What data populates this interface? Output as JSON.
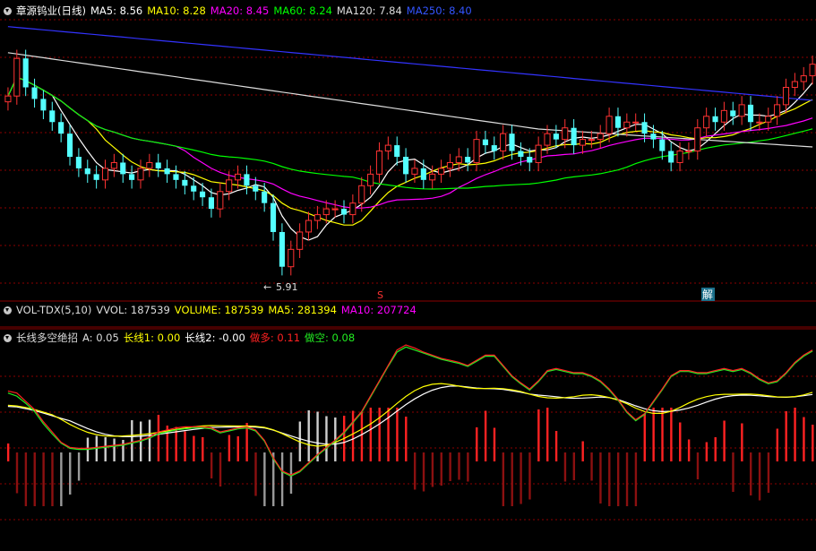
{
  "main_header": {
    "title": "章源钨业(日线)",
    "ma5": "MA5: 8.56",
    "ma10": "MA10: 8.28",
    "ma20": "MA20: 8.45",
    "ma60": "MA60: 8.24",
    "ma120": "MA120: 7.84",
    "ma250": "MA250: 8.40"
  },
  "main_chart": {
    "low_label": "5.91",
    "marker_s": "S",
    "marker_jie": "解"
  },
  "vol_header": {
    "title": "VOL-TDX(5,10)",
    "vvol": "VVOL: 187539",
    "volume": "VOLUME: 187539",
    "ma5": "MA5: 281394",
    "ma10": "MA10: 207724"
  },
  "ind_header": {
    "title": "长线多空绝招",
    "a": "A: 0.05",
    "l1": "长线1: 0.00",
    "l2": "长线2: -0.00",
    "duo": "做多: 0.11",
    "kong": "做空: 0.08"
  },
  "colors": {
    "up": "#ff3333",
    "down": "#54ffff",
    "ma5": "#ffffff",
    "ma10": "#ffff00",
    "ma20": "#ff00ff",
    "ma60": "#00ff00",
    "ma120": "#dddddd",
    "ma250": "#3333ff",
    "grid": "#8b0000"
  },
  "chart_data": [
    {
      "type": "candlestick",
      "title": "章源钨业(日线)",
      "price_range": [
        5.5,
        10.3
      ],
      "min_price_label": 5.91,
      "close": [
        8.95,
        9.6,
        9.1,
        8.9,
        8.7,
        8.5,
        8.3,
        7.9,
        7.7,
        7.6,
        7.5,
        7.7,
        7.8,
        7.6,
        7.5,
        7.7,
        7.8,
        7.7,
        7.6,
        7.5,
        7.4,
        7.3,
        7.2,
        7.0,
        7.3,
        7.5,
        7.6,
        7.4,
        7.3,
        7.1,
        6.6,
        6.0,
        6.3,
        6.6,
        6.8,
        6.9,
        7.0,
        7.0,
        6.9,
        7.1,
        7.4,
        7.6,
        8.0,
        8.1,
        7.9,
        7.6,
        7.7,
        7.5,
        7.6,
        7.7,
        7.8,
        7.9,
        7.8,
        8.2,
        8.1,
        8.0,
        8.3,
        8.0,
        7.9,
        7.8,
        8.1,
        8.3,
        8.2,
        8.4,
        8.1,
        8.2,
        8.2,
        8.3,
        8.6,
        8.4,
        8.5,
        8.5,
        8.3,
        8.2,
        8.0,
        7.8,
        8.0,
        8.0,
        8.4,
        8.6,
        8.5,
        8.7,
        8.6,
        8.8,
        8.5,
        8.5,
        8.6,
        8.8,
        9.1,
        9.2,
        9.3,
        9.5
      ],
      "ma_latest": {
        "MA5": 8.56,
        "MA10": 8.28,
        "MA20": 8.45,
        "MA60": 8.24,
        "MA120": 7.84,
        "MA250": 8.4
      }
    },
    {
      "type": "bar",
      "title": "VOL-TDX(5,10)",
      "VVOL": 187539,
      "VOLUME": 187539,
      "MA5": 281394,
      "MA10": 207724
    },
    {
      "type": "line",
      "title": "长线多空绝招",
      "series": [
        {
          "name": "做多",
          "values": [
            0.6,
            0.58,
            0.5,
            0.42,
            0.3,
            0.2,
            0.1,
            0.05,
            0.04,
            0.04,
            0.05,
            0.06,
            0.07,
            0.08,
            0.1,
            0.12,
            0.15,
            0.2,
            0.22,
            0.24,
            0.25,
            0.25,
            0.25,
            0.24,
            0.2,
            0.22,
            0.24,
            0.25,
            0.22,
            0.12,
            -0.05,
            -0.18,
            -0.22,
            -0.18,
            -0.1,
            -0.02,
            0.05,
            0.12,
            0.2,
            0.3,
            0.4,
            0.55,
            0.7,
            0.85,
            1.0,
            1.05,
            1.02,
            0.98,
            0.95,
            0.92,
            0.9,
            0.88,
            0.85,
            0.9,
            0.95,
            0.95,
            0.85,
            0.75,
            0.68,
            0.62,
            0.7,
            0.8,
            0.82,
            0.8,
            0.78,
            0.78,
            0.75,
            0.7,
            0.62,
            0.52,
            0.4,
            0.32,
            0.38,
            0.5,
            0.62,
            0.75,
            0.8,
            0.8,
            0.78,
            0.78,
            0.8,
            0.82,
            0.8,
            0.82,
            0.78,
            0.72,
            0.68,
            0.7,
            0.78,
            0.88,
            0.95,
            1.0
          ]
        },
        {
          "name": "做空",
          "values": [
            0.58,
            0.55,
            0.48,
            0.4,
            0.28,
            0.18,
            0.09,
            0.04,
            0.03,
            0.03,
            0.04,
            0.05,
            0.06,
            0.07,
            0.09,
            0.11,
            0.14,
            0.18,
            0.2,
            0.22,
            0.23,
            0.24,
            0.24,
            0.23,
            0.19,
            0.21,
            0.23,
            0.24,
            0.21,
            0.11,
            -0.06,
            -0.19,
            -0.23,
            -0.19,
            -0.11,
            -0.03,
            0.04,
            0.11,
            0.19,
            0.29,
            0.39,
            0.54,
            0.69,
            0.84,
            0.98,
            1.03,
            1.0,
            0.97,
            0.94,
            0.91,
            0.89,
            0.87,
            0.84,
            0.89,
            0.94,
            0.94,
            0.84,
            0.74,
            0.67,
            0.61,
            0.69,
            0.79,
            0.81,
            0.79,
            0.77,
            0.77,
            0.74,
            0.69,
            0.61,
            0.51,
            0.39,
            0.31,
            0.37,
            0.49,
            0.61,
            0.74,
            0.79,
            0.79,
            0.77,
            0.77,
            0.79,
            0.81,
            0.79,
            0.81,
            0.77,
            0.71,
            0.67,
            0.69,
            0.77,
            0.87,
            0.94,
            0.99
          ]
        }
      ],
      "latest": {
        "A": 0.05,
        "长线1": 0.0,
        "长线2": -0.0,
        "做多": 0.11,
        "做空": 0.08
      }
    }
  ]
}
